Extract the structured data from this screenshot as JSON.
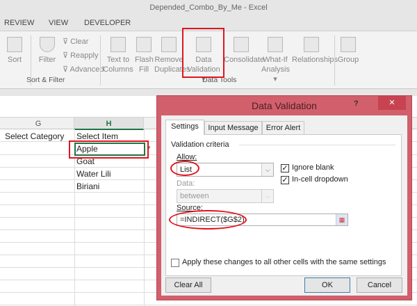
{
  "window": {
    "title": "Depended_Combo_By_Me - Excel"
  },
  "ribbon_tabs": [
    "REVIEW",
    "VIEW",
    "DEVELOPER"
  ],
  "ribbon": {
    "sort": "Sort",
    "filter": "Filter",
    "clear": "Clear",
    "reapply": "Reapply",
    "advanced": "Advanced",
    "sort_filter_group": "Sort & Filter",
    "text_to_columns": [
      "Text to",
      "Columns"
    ],
    "flash_fill": [
      "Flash",
      "Fill"
    ],
    "remove_duplicates": [
      "Remove",
      "Duplicates"
    ],
    "data_validation": [
      "Data",
      "Validation"
    ],
    "consolidate": "Consolidate",
    "what_if": [
      "What-If",
      "Analysis"
    ],
    "relationships": "Relationships",
    "group": "Group",
    "data_tools_group": "Data Tools"
  },
  "sheet": {
    "columns": [
      "G",
      "H"
    ],
    "g1": "Select Category",
    "h_cells": [
      "Select Item",
      "Apple",
      "Goat",
      "Water Lili",
      "Biriani"
    ]
  },
  "dialog": {
    "title": "Data Validation",
    "help": "?",
    "close": "✕",
    "tabs": [
      "Settings",
      "Input Message",
      "Error Alert"
    ],
    "criteria": "Validation criteria",
    "allow_label": "Allow:",
    "allow_value": "List",
    "ignore_blank": "Ignore blank",
    "ignore_blank_checked": true,
    "in_cell": "In-cell dropdown",
    "in_cell_checked": true,
    "data_label": "Data:",
    "data_value": "between",
    "source_label": "Source:",
    "source_value": "=INDIRECT($G$2)",
    "apply_all": "Apply these changes to all other cells with the same settings",
    "clear_all": "Clear All",
    "ok": "OK",
    "cancel": "Cancel"
  },
  "colors": {
    "annotation": "#e0141e",
    "dialog_frame": "#d25f6c",
    "selected_cell": "#217346"
  }
}
